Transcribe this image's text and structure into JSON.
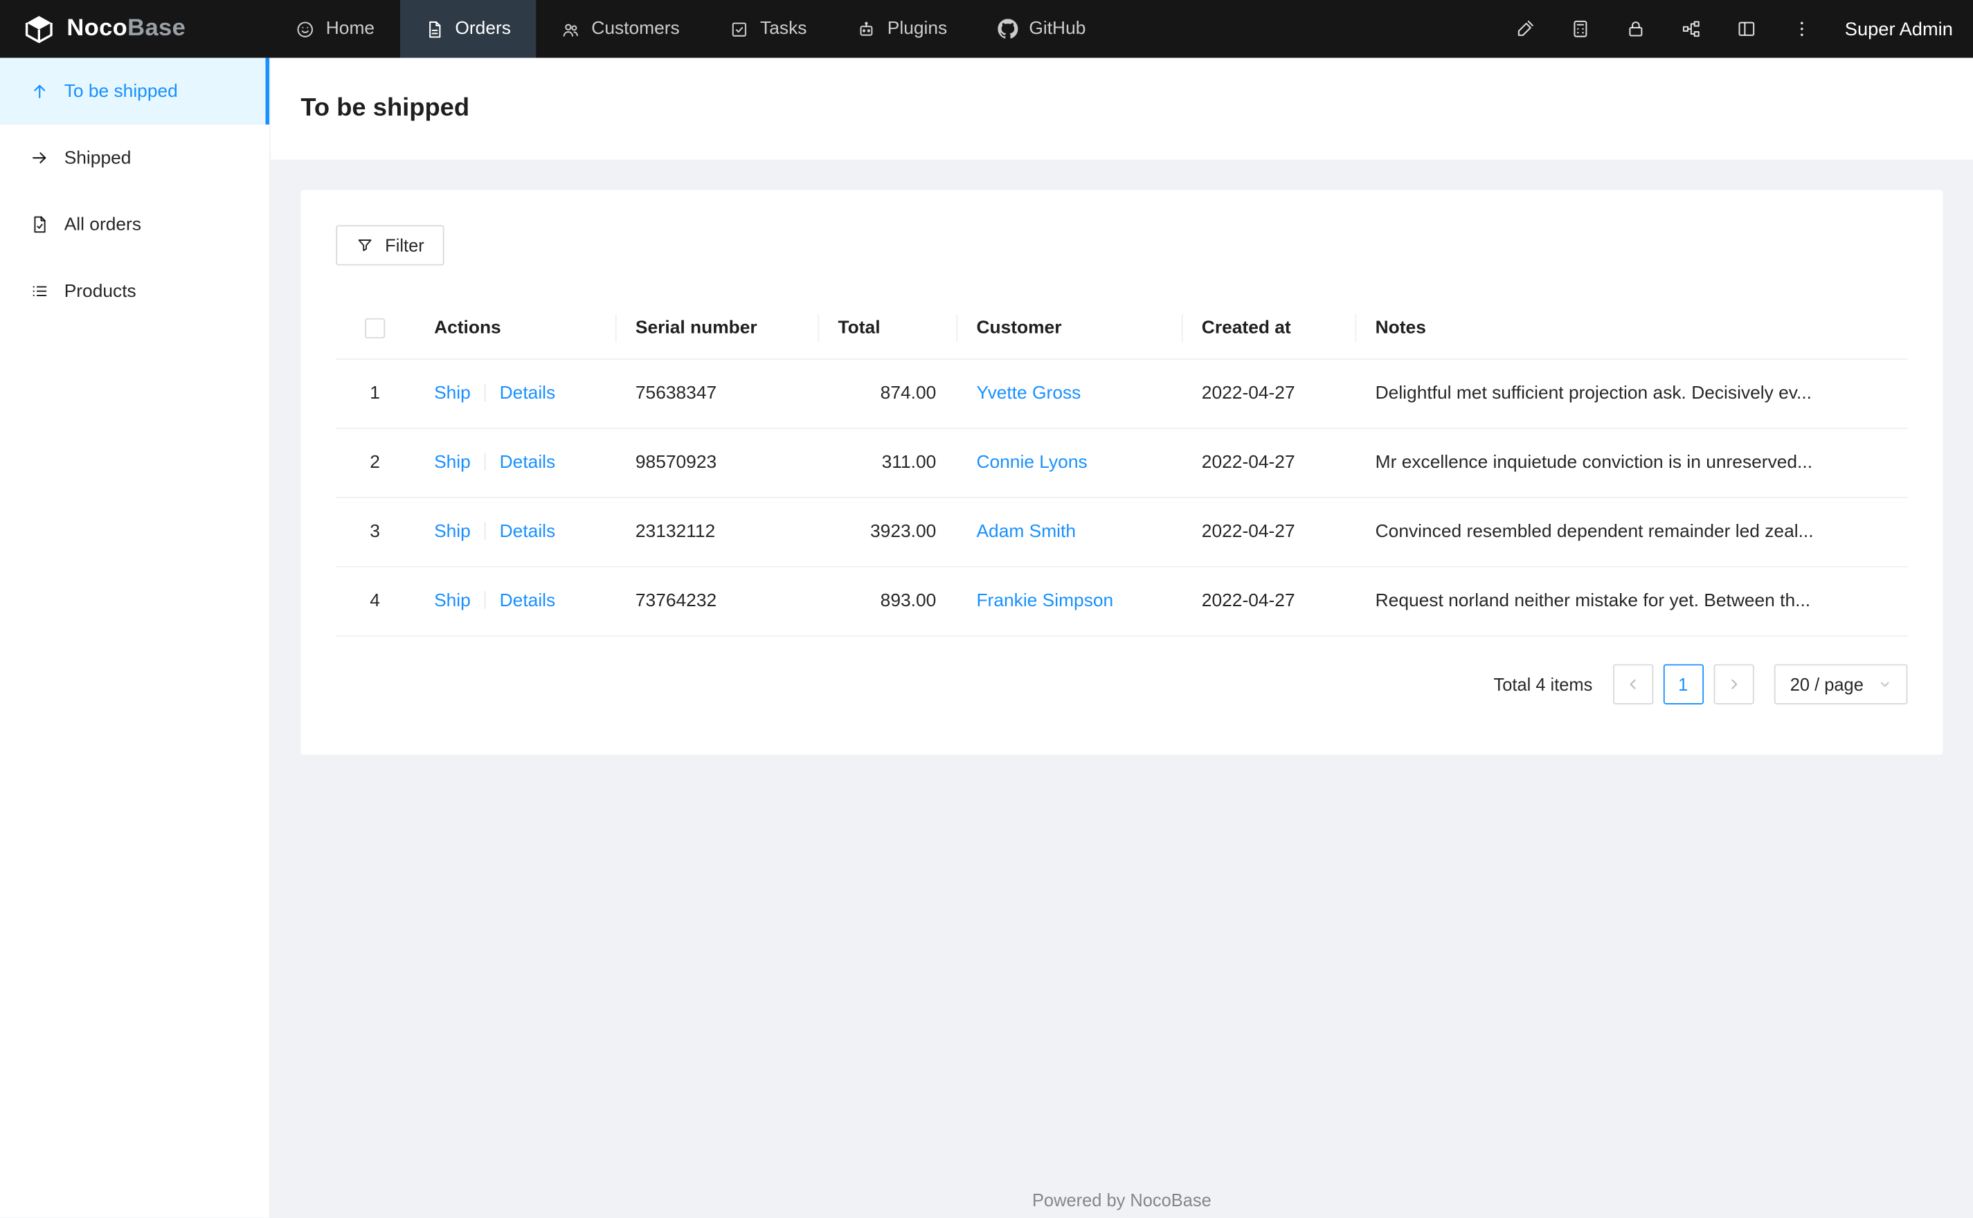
{
  "colors": {
    "accent": "#1890ff",
    "link": "#1890ff",
    "topbar": "#161616",
    "topbar-active": "#2e3a45",
    "sidebar-active": "#e6f7ff",
    "content-bg": "#f0f2f5"
  },
  "topnav": {
    "brand_primary": "Noco",
    "brand_secondary": "Base",
    "items": [
      {
        "label": "Home",
        "icon": "home-smile"
      },
      {
        "label": "Orders",
        "icon": "orders-file",
        "active": true
      },
      {
        "label": "Customers",
        "icon": "team"
      },
      {
        "label": "Tasks",
        "icon": "check-square"
      },
      {
        "label": "Plugins",
        "icon": "robot"
      },
      {
        "label": "GitHub",
        "icon": "github"
      }
    ],
    "right_icons": [
      "ui-editor-pen",
      "collections-calculator",
      "lock",
      "api-partition",
      "layout",
      "more-ellipsis"
    ],
    "user": "Super Admin"
  },
  "sidebar": {
    "items": [
      {
        "label": "To be shipped",
        "icon": "arrow-up",
        "active": true
      },
      {
        "label": "Shipped",
        "icon": "arrow-right"
      },
      {
        "label": "All orders",
        "icon": "file-done"
      },
      {
        "label": "Products",
        "icon": "list"
      }
    ]
  },
  "page": {
    "title": "To be shipped"
  },
  "toolbar": {
    "filter_label": "Filter"
  },
  "table": {
    "headers": [
      "Actions",
      "Serial number",
      "Total",
      "Customer",
      "Created at",
      "Notes"
    ],
    "rows": [
      {
        "index": "1",
        "actions": {
          "ship": "Ship",
          "details": "Details"
        },
        "serial_number": "75638347",
        "total": "874.00",
        "customer": "Yvette Gross",
        "created_at": "2022-04-27",
        "notes": "Delightful met sufficient projection ask. Decisively ev..."
      },
      {
        "index": "2",
        "actions": {
          "ship": "Ship",
          "details": "Details"
        },
        "serial_number": "98570923",
        "total": "311.00",
        "customer": "Connie Lyons",
        "created_at": "2022-04-27",
        "notes": "Mr excellence inquietude conviction is in unreserved..."
      },
      {
        "index": "3",
        "actions": {
          "ship": "Ship",
          "details": "Details"
        },
        "serial_number": "23132112",
        "total": "3923.00",
        "customer": "Adam Smith",
        "created_at": "2022-04-27",
        "notes": "Convinced resembled dependent remainder led zeal..."
      },
      {
        "index": "4",
        "actions": {
          "ship": "Ship",
          "details": "Details"
        },
        "serial_number": "73764232",
        "total": "893.00",
        "customer": "Frankie Simpson",
        "created_at": "2022-04-27",
        "notes": "Request norland neither mistake for yet. Between th..."
      }
    ]
  },
  "pagination": {
    "total_text": "Total 4 items",
    "current_page": "1",
    "page_size": "20 / page"
  },
  "footer": {
    "text": "Powered by NocoBase"
  }
}
